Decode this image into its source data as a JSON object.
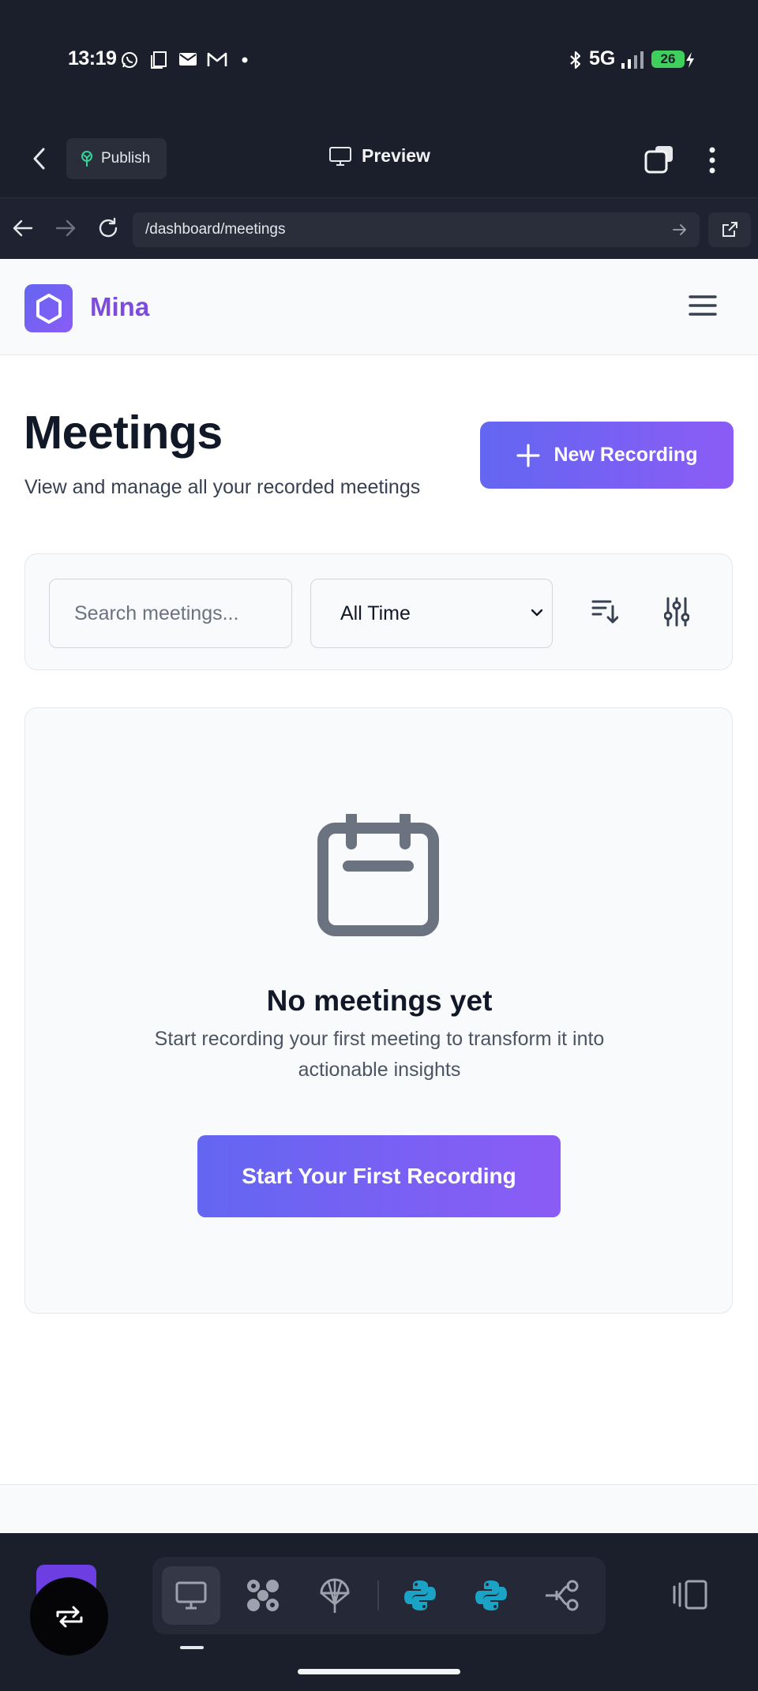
{
  "status_bar": {
    "time": "13:19",
    "network": "5G",
    "battery": "26",
    "icons": [
      "whatsapp-icon",
      "screenshot-icon",
      "mail-icon",
      "gmail-icon",
      "dot-icon",
      "bluetooth-icon",
      "signal-icon",
      "battery-icon"
    ]
  },
  "editor_bar": {
    "publish_label": "Publish",
    "preview_label": "Preview"
  },
  "browser": {
    "url": "/dashboard/meetings"
  },
  "app": {
    "brand": "Mina",
    "page_title": "Meetings",
    "page_subtitle": "View and manage all your recorded meetings",
    "new_recording_label": "New Recording",
    "search_placeholder": "Search meetings...",
    "time_filter": "All Time",
    "empty_title": "No meetings yet",
    "empty_description": "Start recording your first meeting to transform it into actionable insights",
    "first_recording_label": "Start Your First Recording"
  },
  "colors": {
    "accent_start": "#6366f1",
    "accent_end": "#8b5cf6",
    "brand_text": "#7c4ddc",
    "chrome_bg": "#1b1e2b",
    "python_teal": "#1aa3c4"
  }
}
